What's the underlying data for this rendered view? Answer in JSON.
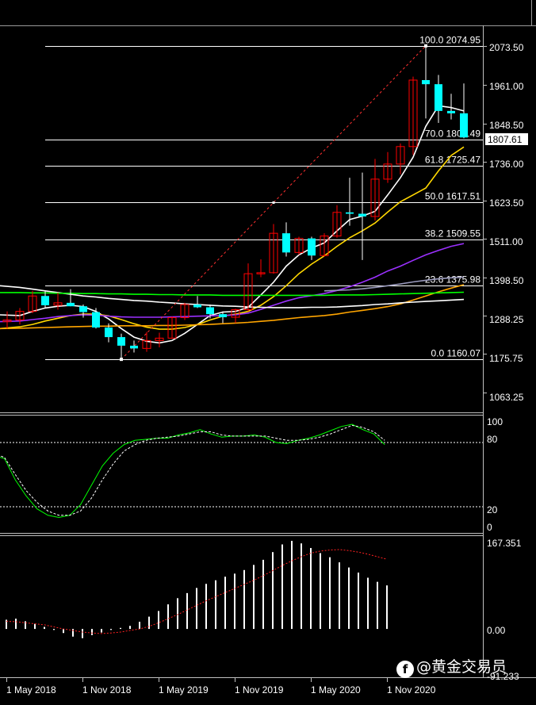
{
  "price_axis": {
    "ticks": [
      "2073.50",
      "1961.00",
      "1848.50",
      "1736.00",
      "1623.50",
      "1511.00",
      "1398.50",
      "1288.25",
      "1175.75",
      "1063.25"
    ]
  },
  "current_price": "1807.61",
  "osc_axis": {
    "ticks": [
      "100",
      "80",
      "20",
      "0"
    ]
  },
  "macd_axis": {
    "ticks": [
      "167.351",
      "0.00",
      "-91.233"
    ]
  },
  "time_axis": {
    "ticks": [
      "1 May 2018",
      "1 Nov 2018",
      "1 May 2019",
      "1 Nov 2019",
      "1 May 2020",
      "1 Nov 2020"
    ]
  },
  "watermark": "@黄金交易员",
  "colors": {
    "up_candle": "#ff0000",
    "down_candle": "#00ffff",
    "fib_line": "#ffffff",
    "stoch_main": "#00ff00",
    "stoch_signal": "#ffffff"
  },
  "chart_data": [
    {
      "type": "candlestick",
      "panel": "price",
      "ylim": [
        1010,
        2130
      ],
      "y_ticks": [
        2073.5,
        1961.0,
        1848.5,
        1736.0,
        1623.5,
        1511.0,
        1398.5,
        1288.25,
        1175.75,
        1063.25
      ],
      "x_ticks": [
        "1 May 2018",
        "1 Nov 2018",
        "1 May 2019",
        "1 Nov 2019",
        "1 May 2020",
        "1 Nov 2020"
      ],
      "months": [
        "2017-11",
        "2017-12",
        "2018-01",
        "2018-02",
        "2018-03",
        "2018-04",
        "2018-05",
        "2018-06",
        "2018-07",
        "2018-08",
        "2018-09",
        "2018-10",
        "2018-11",
        "2018-12",
        "2019-01",
        "2019-02",
        "2019-03",
        "2019-04",
        "2019-05",
        "2019-06",
        "2019-07",
        "2019-08",
        "2019-09",
        "2019-10",
        "2019-11",
        "2019-12",
        "2020-01",
        "2020-02",
        "2020-03",
        "2020-04",
        "2020-05",
        "2020-06",
        "2020-07",
        "2020-08",
        "2020-09",
        "2020-10"
      ],
      "candles": [
        [
          1270,
          1300,
          1250,
          1275
        ],
        [
          1275,
          1310,
          1262,
          1300
        ],
        [
          1300,
          1360,
          1295,
          1345
        ],
        [
          1345,
          1360,
          1310,
          1318
        ],
        [
          1318,
          1355,
          1305,
          1325
        ],
        [
          1325,
          1365,
          1315,
          1315
        ],
        [
          1315,
          1320,
          1282,
          1298
        ],
        [
          1298,
          1310,
          1250,
          1253
        ],
        [
          1253,
          1265,
          1210,
          1225
        ],
        [
          1225,
          1235,
          1160,
          1200
        ],
        [
          1200,
          1215,
          1180,
          1192
        ],
        [
          1192,
          1240,
          1182,
          1215
        ],
        [
          1215,
          1238,
          1195,
          1222
        ],
        [
          1222,
          1285,
          1220,
          1282
        ],
        [
          1282,
          1325,
          1275,
          1320
        ],
        [
          1320,
          1345,
          1310,
          1312
        ],
        [
          1312,
          1320,
          1280,
          1292
        ],
        [
          1292,
          1300,
          1266,
          1283
        ],
        [
          1283,
          1308,
          1266,
          1305
        ],
        [
          1305,
          1440,
          1300,
          1410
        ],
        [
          1410,
          1452,
          1400,
          1413
        ],
        [
          1413,
          1555,
          1410,
          1528
        ],
        [
          1528,
          1560,
          1460,
          1472
        ],
        [
          1472,
          1518,
          1465,
          1513
        ],
        [
          1513,
          1518,
          1450,
          1463
        ],
        [
          1463,
          1528,
          1460,
          1520
        ],
        [
          1520,
          1610,
          1515,
          1589
        ],
        [
          1589,
          1690,
          1550,
          1585
        ],
        [
          1585,
          1705,
          1450,
          1577
        ],
        [
          1577,
          1745,
          1565,
          1686
        ],
        [
          1686,
          1765,
          1675,
          1730
        ],
        [
          1730,
          1790,
          1700,
          1781
        ],
        [
          1781,
          1985,
          1757,
          1975
        ],
        [
          1975,
          2075,
          1863,
          1963
        ],
        [
          1963,
          1990,
          1850,
          1885
        ],
        [
          1885,
          1935,
          1860,
          1878
        ],
        [
          1878,
          1965,
          1805,
          1807.61
        ]
      ],
      "fib_levels": [
        {
          "pct": "100.0",
          "value": 2074.95
        },
        {
          "pct": "70.0",
          "value": 1800.49
        },
        {
          "pct": "61.8",
          "value": 1725.47
        },
        {
          "pct": "50.0",
          "value": 1617.51
        },
        {
          "pct": "38.2",
          "value": 1509.55
        },
        {
          "pct": "23.6",
          "value": 1375.98
        },
        {
          "pct": "0.0",
          "value": 1160.07
        }
      ],
      "trend_line": {
        "from": {
          "month": "2018-08",
          "price": 1160.07
        },
        "to": {
          "month": "2020-08",
          "price": 2074.95
        },
        "mid_price": 1617.51
      },
      "moving_averages": [
        {
          "color": "#ffffff",
          "values": [
            1290,
            1288,
            1300,
            1310,
            1315,
            1318,
            1314,
            1300,
            1278,
            1250,
            1225,
            1213,
            1208,
            1215,
            1236,
            1262,
            1288,
            1298,
            1300,
            1312,
            1348,
            1385,
            1432,
            1465,
            1485,
            1500,
            1535,
            1568,
            1578,
            1592,
            1640,
            1690,
            1750,
            1840,
            1900,
            1895,
            1885
          ]
        },
        {
          "color": "#ffd700",
          "values": [
            1250,
            1255,
            1262,
            1272,
            1280,
            1288,
            1292,
            1292,
            1287,
            1276,
            1264,
            1254,
            1248,
            1248,
            1253,
            1262,
            1275,
            1286,
            1292,
            1300,
            1318,
            1343,
            1375,
            1410,
            1438,
            1462,
            1490,
            1515,
            1535,
            1558,
            1590,
            1620,
            1640,
            1660,
            1710,
            1755,
            1780
          ]
        },
        {
          "color": "#9b30ff",
          "values": [
            1270,
            1272,
            1276,
            1280,
            1285,
            1288,
            1290,
            1289,
            1286,
            1284,
            1283,
            1283,
            1283,
            1284,
            1285,
            1286,
            1287,
            1288,
            1290,
            1295,
            1306,
            1318,
            1330,
            1340,
            1346,
            1352,
            1361,
            1372,
            1385,
            1400,
            1418,
            1432,
            1449,
            1465,
            1478,
            1490,
            1498
          ]
        },
        {
          "color": "#ffa500",
          "values": [
            1250,
            1251,
            1252,
            1253,
            1254,
            1255,
            1256,
            1257,
            1257,
            1258,
            1258,
            1258,
            1259,
            1259,
            1260,
            1261,
            1262,
            1264,
            1266,
            1268,
            1271,
            1274,
            1278,
            1282,
            1285,
            1288,
            1292,
            1298,
            1303,
            1308,
            1314,
            1322,
            1333,
            1345,
            1357,
            1368,
            1378
          ]
        },
        {
          "color": "#ffffff",
          "values": [
            1375,
            1370,
            1365,
            1360,
            1355,
            1350,
            1345,
            1342,
            1338,
            1335,
            1332,
            1330,
            1327,
            1325,
            1322,
            1320,
            1318,
            1316,
            1315,
            1313,
            1312,
            1311,
            1311,
            1311,
            1312,
            1312,
            1313,
            1315,
            1317,
            1320,
            1322,
            1325,
            1327,
            1329,
            1331,
            1333,
            1335
          ]
        },
        {
          "color": "#00ff00",
          "values": [
            1355,
            1355,
            1354,
            1354,
            1353,
            1353,
            1352,
            1352,
            1351,
            1351,
            1350,
            1350,
            1349,
            1349,
            1348,
            1348,
            1348,
            1347,
            1347,
            1347,
            1347,
            1347,
            1347,
            1347,
            1347,
            1347,
            1348,
            1348,
            1348,
            1349,
            1350,
            1351,
            1352,
            1353,
            1354,
            1355,
            1356
          ]
        },
        {
          "color": "#9999bb",
          "values": [
            null,
            null,
            null,
            null,
            null,
            null,
            null,
            null,
            null,
            null,
            null,
            null,
            null,
            null,
            null,
            null,
            null,
            null,
            null,
            null,
            null,
            null,
            null,
            null,
            null,
            null,
            1360,
            1363,
            1366,
            1370,
            1375,
            1380,
            1386,
            1391,
            1395,
            1398,
            1400
          ]
        }
      ]
    },
    {
      "type": "line",
      "panel": "stochastic",
      "ylim": [
        0,
        100
      ],
      "levels": [
        80,
        20
      ],
      "series": [
        {
          "color": "#00ff00",
          "values": [
            68,
            65,
            45,
            30,
            18,
            12,
            10,
            12,
            22,
            40,
            58,
            70,
            78,
            82,
            83,
            84,
            84,
            87,
            89,
            92,
            88,
            85,
            86,
            86,
            87,
            85,
            80,
            79,
            82,
            84,
            87,
            91,
            95,
            97,
            92,
            88,
            78
          ]
        },
        {
          "color": "#ffffff",
          "values": [
            70,
            66,
            50,
            35,
            24,
            16,
            12,
            12,
            16,
            28,
            45,
            60,
            72,
            78,
            82,
            84,
            85,
            86,
            88,
            90,
            90,
            87,
            86,
            86,
            86,
            86,
            84,
            82,
            82,
            83,
            85,
            88,
            92,
            96,
            94,
            90,
            82
          ]
        }
      ]
    },
    {
      "type": "bar",
      "panel": "macd",
      "ylim": [
        -91.233,
        167.351
      ],
      "histogram": [
        18,
        20,
        15,
        10,
        4,
        -2,
        -8,
        -15,
        -18,
        -12,
        -7,
        -2,
        2,
        6,
        14,
        24,
        35,
        48,
        60,
        70,
        80,
        88,
        95,
        102,
        108,
        115,
        125,
        135,
        150,
        165,
        172,
        167,
        158,
        148,
        140,
        130,
        120,
        110,
        100,
        92,
        85
      ],
      "signal": [
        15,
        14,
        12,
        10,
        8,
        4,
        0,
        -3,
        -6,
        -8,
        -9,
        -8,
        -6,
        -3,
        0,
        5,
        12,
        20,
        28,
        37,
        46,
        55,
        63,
        71,
        79,
        87,
        95,
        104,
        114,
        124,
        133,
        141,
        148,
        152,
        154,
        155,
        153,
        150,
        146,
        141,
        136
      ]
    }
  ]
}
